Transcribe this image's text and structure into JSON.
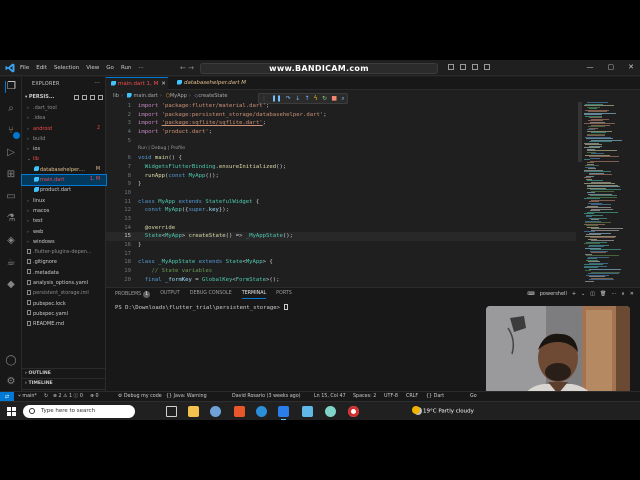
{
  "titlebar": {
    "menu": [
      "File",
      "Edit",
      "Selection",
      "View",
      "Go",
      "Run"
    ],
    "banner": "www.BANDICAM.com",
    "nav_arrows": "←  →"
  },
  "explorer": {
    "title": "EXPLORER",
    "project": "PERSIS...",
    "items": [
      {
        "label": ".dart_tool",
        "indent": 1,
        "kind": "folder",
        "color": "gray",
        "badge": ""
      },
      {
        "label": ".idea",
        "indent": 1,
        "kind": "folder",
        "color": "gray",
        "badge": ""
      },
      {
        "label": "android",
        "indent": 1,
        "kind": "folder",
        "color": "red",
        "badge": "2"
      },
      {
        "label": "build",
        "indent": 1,
        "kind": "folder",
        "color": "gray",
        "badge": ""
      },
      {
        "label": "ios",
        "indent": 1,
        "kind": "folder",
        "color": "default",
        "badge": ""
      },
      {
        "label": "lib",
        "indent": 1,
        "kind": "folder-open",
        "color": "red",
        "badge": ""
      },
      {
        "label": "databasehelper....",
        "indent": 2,
        "kind": "dart",
        "color": "yellow",
        "badge": "M"
      },
      {
        "label": "main.dart",
        "indent": 2,
        "kind": "dart",
        "color": "red",
        "badge": "1, M",
        "active": true
      },
      {
        "label": "product.dart",
        "indent": 2,
        "kind": "dart",
        "color": "default",
        "badge": ""
      },
      {
        "label": "linux",
        "indent": 1,
        "kind": "folder",
        "color": "default",
        "badge": ""
      },
      {
        "label": "macos",
        "indent": 1,
        "kind": "folder",
        "color": "default",
        "badge": ""
      },
      {
        "label": "test",
        "indent": 1,
        "kind": "folder",
        "color": "default",
        "badge": ""
      },
      {
        "label": "web",
        "indent": 1,
        "kind": "folder",
        "color": "default",
        "badge": ""
      },
      {
        "label": "windows",
        "indent": 1,
        "kind": "folder",
        "color": "default",
        "badge": ""
      },
      {
        "label": ".flutter-plugins-depen...",
        "indent": 1,
        "kind": "file",
        "color": "gray",
        "badge": ""
      },
      {
        "label": ".gitignore",
        "indent": 1,
        "kind": "file",
        "color": "default",
        "badge": ""
      },
      {
        "label": ".metadata",
        "indent": 1,
        "kind": "file",
        "color": "default",
        "badge": ""
      },
      {
        "label": "analysis_options.yaml",
        "indent": 1,
        "kind": "file",
        "color": "default",
        "badge": ""
      },
      {
        "label": "persistent_storage.iml",
        "indent": 1,
        "kind": "file",
        "color": "gray",
        "badge": ""
      },
      {
        "label": "pubspec.lock",
        "indent": 1,
        "kind": "file",
        "color": "default",
        "badge": ""
      },
      {
        "label": "pubspec.yaml",
        "indent": 1,
        "kind": "file",
        "color": "default",
        "badge": ""
      },
      {
        "label": "README.md",
        "indent": 1,
        "kind": "file",
        "color": "default",
        "badge": ""
      }
    ],
    "sections": [
      "OUTLINE",
      "TIMELINE",
      "DEPENDENCIES",
      "JAVA PROJECTS"
    ]
  },
  "tabs": [
    {
      "label": "main.dart 1, M",
      "active": true
    },
    {
      "label": "databasehelper.dart M",
      "active": false
    }
  ],
  "breadcrumbs": [
    "lib",
    "main.dart",
    "MyApp",
    "createState"
  ],
  "codelens": "Run | Debug | Profile",
  "code": {
    "line1": "import 'package:flutter/material.dart';",
    "line2a": "import ",
    "line2b": "'package:persistent_storage/databasehelper.dart'",
    "line2c": ";",
    "line3a": "import ",
    "line3b": "'package:sqflite/sqflite.dart'",
    "line3c": ";",
    "line4a": "import ",
    "line4b": "'product.dart'",
    "line4c": ";",
    "line6": "void main() {",
    "line7": "  WidgetsFlutterBinding.ensureInitialized();",
    "line8": "  runApp(const MyApp());",
    "line9": "}",
    "line11": "class MyApp extends StatefulWidget {",
    "line12": "  const MyApp({super.key});",
    "line14": "  @override",
    "line15": "  State<MyApp> createState() => _MyAppState();",
    "line16": "}",
    "line18": "class _MyAppState extends State<MyApp> {",
    "line19": "  // State variables",
    "line20": "  final _formKey = GlobalKey<FormState>();"
  },
  "panel": {
    "tabs": [
      "PROBLEMS",
      "OUTPUT",
      "DEBUG CONSOLE",
      "TERMINAL",
      "PORTS"
    ],
    "problems_count": "1",
    "active_tab": "TERMINAL",
    "shell": "powershell",
    "terminal_line": "PS D:\\Downloads\\flutter_trial\\persistent_storage> "
  },
  "status": {
    "branch": "main*",
    "errors": "2",
    "warnings": "1",
    "info": "0",
    "debug": "Debug my code",
    "java": "Java: Warning",
    "blame": "David Rosario (3 weeks ago)",
    "position": "Ln 15, Col 47",
    "spaces": "Spaces: 2",
    "encoding": "UTF-8",
    "eol": "CRLF",
    "language": "Dart",
    "go_live": "Go"
  },
  "taskbar": {
    "search_placeholder": "Type here to search",
    "weather": "19°C  Partly cloudy"
  },
  "colors": {
    "accent": "#0078d4",
    "editor_bg": "#1f1f1f",
    "sidebar_bg": "#181818",
    "error": "#f14c4c",
    "modified": "#e2c08d"
  }
}
